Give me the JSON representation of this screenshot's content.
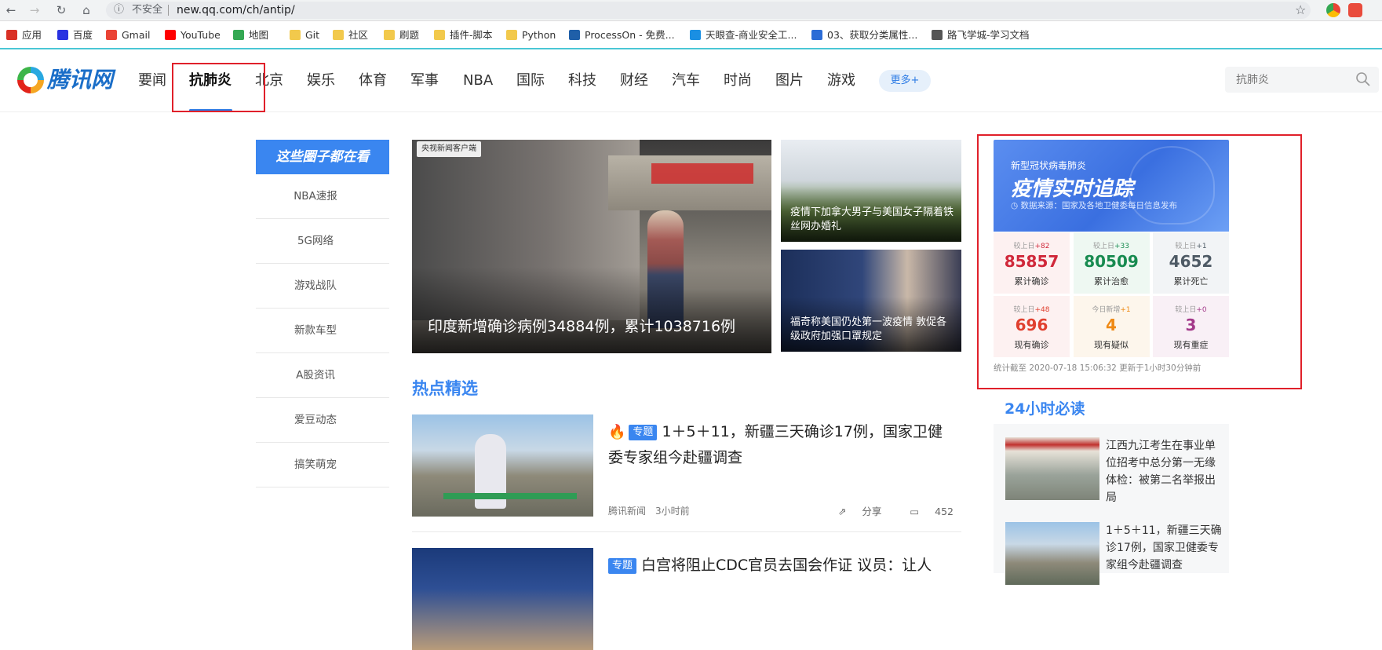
{
  "browser": {
    "security_label": "不安全",
    "url": "new.qq.com/ch/antip/",
    "bookmarks": [
      {
        "label": "应用",
        "color": "#d93025"
      },
      {
        "label": "百度",
        "color": "#2932e1"
      },
      {
        "label": "Gmail",
        "color": "#ea4335"
      },
      {
        "label": "YouTube",
        "color": "#ff0000"
      },
      {
        "label": "地图",
        "color": "#34a853"
      },
      {
        "label": "Git",
        "color": "#f2c94c"
      },
      {
        "label": "社区",
        "color": "#f2c94c"
      },
      {
        "label": "刷题",
        "color": "#f2c94c"
      },
      {
        "label": "插件-脚本",
        "color": "#f2c94c"
      },
      {
        "label": "Python",
        "color": "#f2c94c"
      },
      {
        "label": "ProcessOn - 免费...",
        "color": "#1f5fa8"
      },
      {
        "label": "天眼查-商业安全工...",
        "color": "#1a8fe3"
      },
      {
        "label": "03、获取分类属性...",
        "color": "#2b6cd6"
      },
      {
        "label": "路飞学城-学习文档",
        "color": "#555555"
      }
    ]
  },
  "header": {
    "logo_text": "腾讯网",
    "nav": [
      "要闻",
      "抗肺炎",
      "北京",
      "娱乐",
      "体育",
      "军事",
      "NBA",
      "国际",
      "科技",
      "财经",
      "汽车",
      "时尚",
      "图片",
      "游戏"
    ],
    "active_nav": "抗肺炎",
    "more_label": "更多+",
    "search_placeholder": "抗肺炎"
  },
  "sidebar": {
    "title": "这些圈子都在看",
    "items": [
      "NBA速报",
      "5G网络",
      "游戏战队",
      "新款车型",
      "A股资讯",
      "爱豆动态",
      "搞笑萌宠"
    ]
  },
  "main": {
    "hero": {
      "badge": "央视新闻客户端",
      "caption": "印度新增确诊病例34884例，累计1038716例"
    },
    "side_news": [
      {
        "caption": "疫情下加拿大男子与美国女子隔着铁丝网办婚礼"
      },
      {
        "caption": "福奇称美国仍处第一波疫情 敦促各级政府加强口罩规定"
      }
    ],
    "hot_title": "热点精选",
    "articles": [
      {
        "tag": "专题",
        "title": "1＋5＋11，新疆三天确诊17例，国家卫健委专家组今赴疆调查",
        "source": "腾讯新闻",
        "time": "3小时前",
        "share": "分享",
        "comments": "452"
      },
      {
        "tag": "专题",
        "title": "白宫将阻止CDC官员去国会作证 议员：让人"
      }
    ]
  },
  "epidemic": {
    "subtitle": "新型冠状病毒肺炎",
    "title": "疫情实时追踪",
    "source": "数据来源：国家及各地卫健委每日信息发布",
    "stats": [
      {
        "delta_label": "较上日",
        "delta": "+82",
        "value": "85857",
        "label": "累计确诊",
        "color": "#d0283a",
        "bg": "#fdf1f1"
      },
      {
        "delta_label": "较上日",
        "delta": "+33",
        "value": "80509",
        "label": "累计治愈",
        "color": "#178b50",
        "bg": "#eef8f2"
      },
      {
        "delta_label": "较上日",
        "delta": "+1",
        "value": "4652",
        "label": "累计死亡",
        "color": "#4e5a65",
        "bg": "#f2f4f6"
      },
      {
        "delta_label": "较上日",
        "delta": "+48",
        "value": "696",
        "label": "现有确诊",
        "color": "#e0402f",
        "bg": "#fdf1f1"
      },
      {
        "delta_label": "今日新增",
        "delta": "+1",
        "value": "4",
        "label": "现有疑似",
        "color": "#ef8a15",
        "bg": "#fdf6ec"
      },
      {
        "delta_label": "较上日",
        "delta": "+0",
        "value": "3",
        "label": "现有重症",
        "color": "#a3398a",
        "bg": "#f9f0f6"
      }
    ],
    "footer": "统计截至 2020-07-18 15:06:32 更新于1小时30分钟前"
  },
  "must_read": {
    "title": "24小时必读",
    "items": [
      {
        "title": "江西九江考生在事业单位招考中总分第一无缘体检：被第二名举报出局"
      },
      {
        "title": "1＋5＋11，新疆三天确诊17例，国家卫健委专家组今赴疆调查"
      }
    ]
  }
}
